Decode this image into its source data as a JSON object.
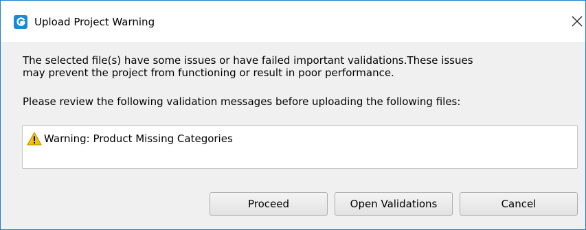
{
  "window": {
    "title": "Upload Project Warning",
    "icon": "app-logo-icon",
    "close_icon": "close-icon"
  },
  "message": {
    "line1": "The selected file(s) have some issues or have failed important validations.These issues",
    "line2": "may prevent the project from functioning or result in poor performance."
  },
  "prompt": "Please review the following validation messages before uploading the following files:",
  "validations": [
    {
      "icon": "warning-icon",
      "text": "Warning: Product Missing Categories"
    }
  ],
  "buttons": {
    "proceed": "Proceed",
    "open_validations": "Open Validations",
    "cancel": "Cancel"
  },
  "colors": {
    "accent": "#1a7fc9",
    "dialog_bg": "#f0f0f0",
    "warning": "#f5c400"
  }
}
